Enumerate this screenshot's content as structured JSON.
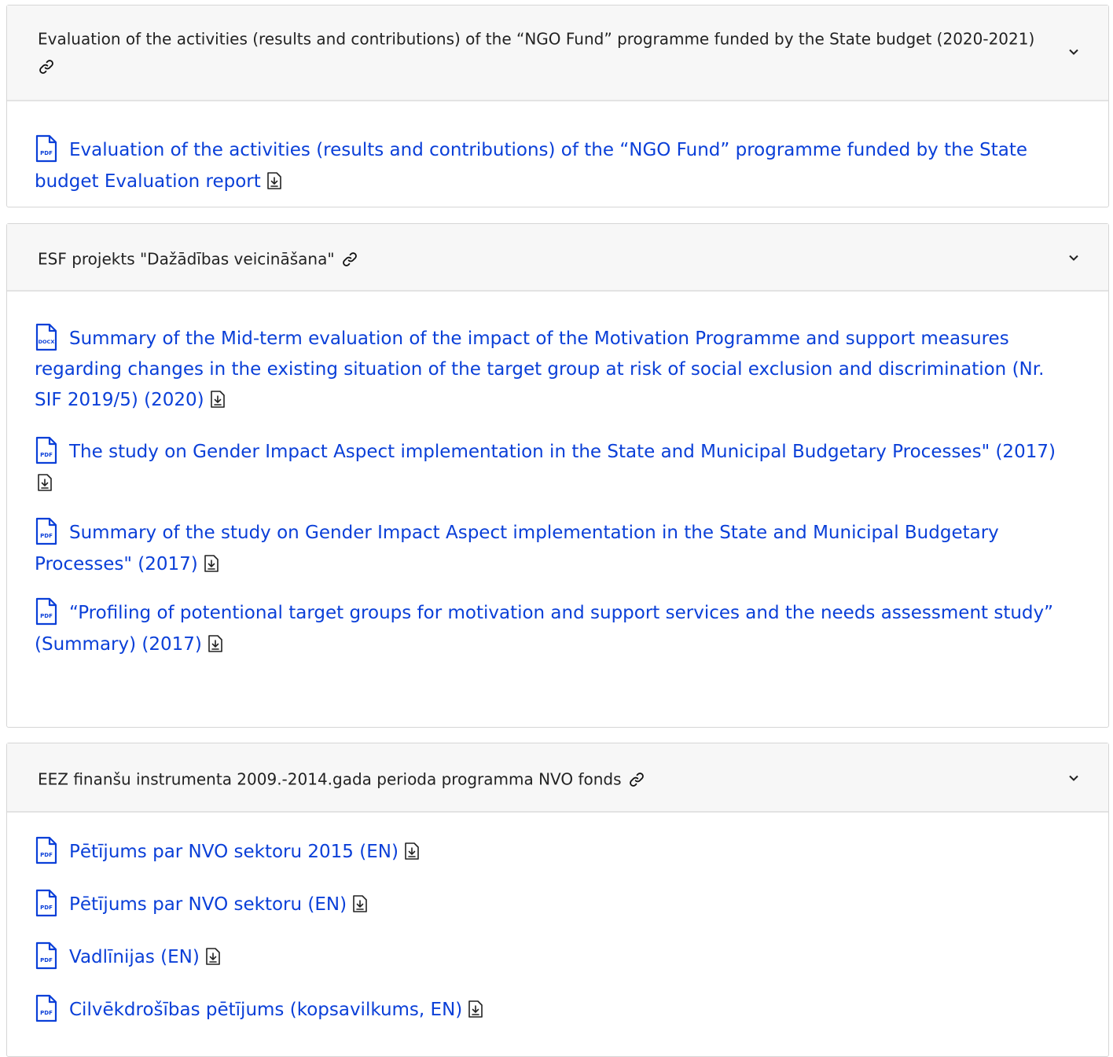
{
  "sections": [
    {
      "title": "Evaluation of the activities (results and contributions) of the “NGO Fund” programme funded by the State budget (2020-2021)",
      "link_icon": "link-icon",
      "toggle_icon": "chevron-down-icon",
      "documents": [
        {
          "type": "PDF",
          "label": "Evaluation of the activities (results and contributions) of the “NGO Fund” programme funded by the State budget Evaluation report",
          "download_icon": "download-icon"
        }
      ]
    },
    {
      "title": "ESF projekts \"Dažādības veicināšana\"",
      "link_icon": "link-icon",
      "toggle_icon": "chevron-down-icon",
      "documents": [
        {
          "type": "DOCX",
          "label": "Summary of the Mid-term evaluation of the impact of the Motivation Programme and support measures regarding changes in the existing situation of the target group at risk of social exclusion and discrimination (Nr. SIF 2019/5) (2020)",
          "download_icon": "download-icon"
        },
        {
          "type": "PDF",
          "label": "The study on Gender Impact Aspect implementation in the State and Municipal Budgetary Processes\" (2017)",
          "download_icon": "download-icon"
        },
        {
          "type": "PDF",
          "label": "Summary of the study on Gender Impact Aspect implementation in the State and Municipal Budgetary Processes\" (2017)",
          "download_icon": "download-icon"
        },
        {
          "type": "PDF",
          "label": "“Profiling of potentional target groups for motivation and support services and the needs assessment study” (Summary) (2017)",
          "download_icon": "download-icon"
        }
      ]
    },
    {
      "title": "EEZ finanšu instrumenta 2009.-2014.gada perioda programma NVO fonds",
      "link_icon": "link-icon",
      "toggle_icon": "chevron-down-icon",
      "documents": [
        {
          "type": "PDF",
          "label": "Pētījums par NVO sektoru 2015 (EN)",
          "download_icon": "download-icon"
        },
        {
          "type": "PDF",
          "label": "Pētījums par NVO sektoru (EN)",
          "download_icon": "download-icon"
        },
        {
          "type": "PDF",
          "label": "Vadlīnijas (EN)",
          "download_icon": "download-icon"
        },
        {
          "type": "PDF",
          "label": "Cilvēkdrošības pētījums (kopsavilkums, EN)",
          "download_icon": "download-icon"
        }
      ]
    }
  ],
  "colors": {
    "link": "#0a3fd8",
    "header_bg": "#f7f7f7",
    "border": "#d6d6d6",
    "text": "#222222"
  }
}
